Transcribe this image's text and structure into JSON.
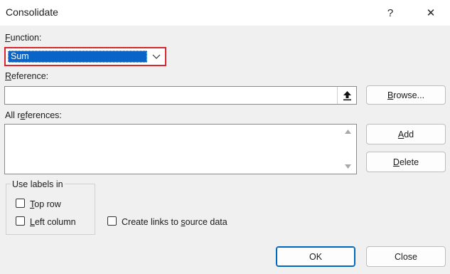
{
  "dialog": {
    "title": "Consolidate",
    "help_glyph": "?",
    "close_glyph": "✕"
  },
  "function": {
    "label_accel": "F",
    "label_rest": "unction:",
    "selected": "Sum"
  },
  "reference": {
    "label_accel": "R",
    "label_rest": "eference:",
    "value": ""
  },
  "all_references": {
    "label_pre": "All r",
    "label_accel": "e",
    "label_rest": "ferences:",
    "items": []
  },
  "buttons": {
    "browse_accel": "B",
    "browse_rest": "rowse...",
    "add_accel": "A",
    "add_rest": "dd",
    "delete_accel": "D",
    "delete_rest": "elete",
    "ok": "OK",
    "close": "Close"
  },
  "use_labels": {
    "title": "Use labels in",
    "top_row_accel": "T",
    "top_row_rest": "op row",
    "top_row_checked": false,
    "left_column_accel": "L",
    "left_column_rest": "eft column",
    "left_column_checked": false
  },
  "create_links": {
    "label_pre": "Create links to ",
    "label_accel": "s",
    "label_rest": "ource data",
    "checked": false
  },
  "colors": {
    "highlight": "#d9262c",
    "selection": "#0a64c8",
    "default_button_border": "#0067c0"
  },
  "icons": [
    "upload-arrow-icon",
    "chevron-down-icon",
    "scroll-up-icon",
    "scroll-down-icon"
  ]
}
